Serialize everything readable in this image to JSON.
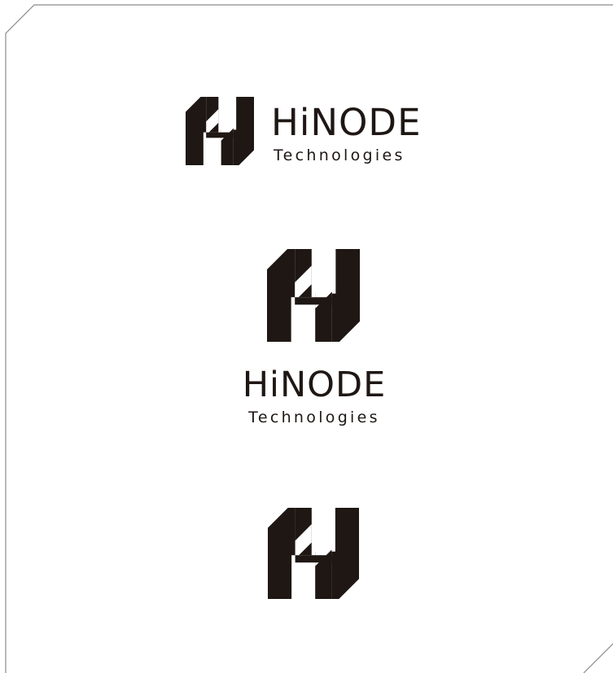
{
  "brand": {
    "name": "HiNODE",
    "tagline": "Technologies",
    "ink_color": "#1e1714",
    "frame_color": "#8a8a8a"
  },
  "lockups": [
    {
      "variant": "horizontal",
      "title": "HiNODE",
      "subtitle": "Technologies",
      "icon": "hinode-h-icon"
    },
    {
      "variant": "vertical",
      "title": "HiNODE",
      "subtitle": "Technologies",
      "icon": "hinode-h-icon"
    },
    {
      "variant": "symbol",
      "icon": "hinode-h-icon"
    }
  ]
}
